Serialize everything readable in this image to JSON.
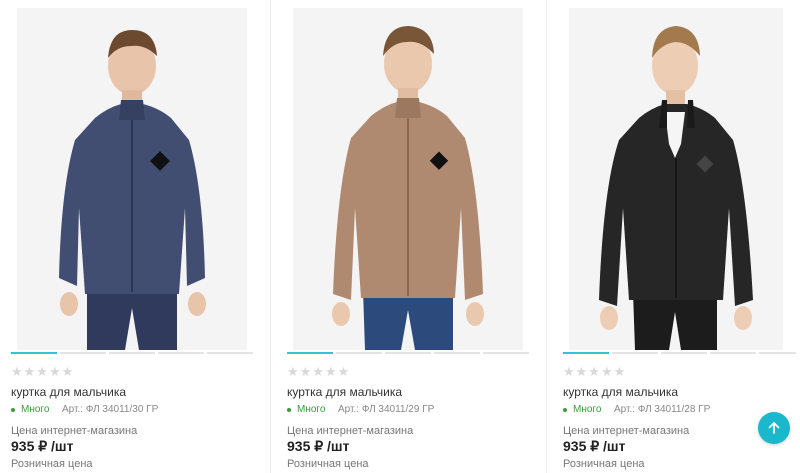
{
  "products": [
    {
      "title": "куртка для мальчика",
      "rating_stars": "★★★★★",
      "stock": "Много",
      "article": "Арт.: ФЛ 34011/30 ГР",
      "price_label": "Цена интернет-магазина",
      "price": "935 ₽ /шт",
      "retail_label": "Розничная цена",
      "jacket_color": "#414e72",
      "pants_color": "#2f3a5c",
      "image_count": 5,
      "active_image": 1
    },
    {
      "title": "куртка для мальчика",
      "rating_stars": "★★★★★",
      "stock": "Много",
      "article": "Арт.: ФЛ 34011/29 ГР",
      "price_label": "Цена интернет-магазина",
      "price": "935 ₽ /шт",
      "retail_label": "Розничная цена",
      "jacket_color": "#b08a70",
      "pants_color": "#2d4a7c",
      "image_count": 5,
      "active_image": 1
    },
    {
      "title": "куртка для мальчика",
      "rating_stars": "★★★★★",
      "stock": "Много",
      "article": "Арт.: ФЛ 34011/28 ГР",
      "price_label": "Цена интернет-магазина",
      "price": "935 ₽ /шт",
      "retail_label": "Розничная цена",
      "jacket_color": "#262626",
      "pants_color": "#1c1c1c",
      "image_count": 5,
      "active_image": 1
    }
  ],
  "scroll_top_icon": "arrow-up-icon",
  "accent_color": "#19b8cc",
  "stock_color": "#3a9d3a"
}
